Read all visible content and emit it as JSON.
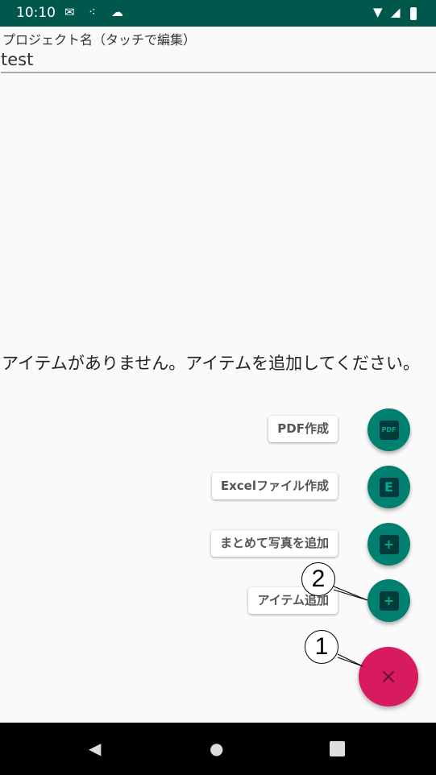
{
  "status_bar": {
    "time": "10:10",
    "icons": [
      "gmail-icon",
      "dots-icon",
      "cloud-icon",
      "wifi-icon",
      "signal-icon",
      "battery-icon"
    ]
  },
  "project": {
    "label": "プロジェクト名（タッチで編集）",
    "value": "test"
  },
  "empty_message": "アイテムがありません。アイテムを追加してください。",
  "fab_menu": [
    {
      "label": "PDF作成",
      "icon": "pdf-icon",
      "glyph": "PDF"
    },
    {
      "label": "Excelファイル作成",
      "icon": "excel-icon",
      "glyph": "E"
    },
    {
      "label": "まとめて写真を追加",
      "icon": "add-photos-icon",
      "glyph": "+"
    },
    {
      "label": "アイテム追加",
      "icon": "add-item-icon",
      "glyph": "+"
    }
  ],
  "main_fab": {
    "icon": "close-icon",
    "glyph": "×",
    "color": "#d81b60"
  },
  "annotations": [
    "1",
    "2"
  ],
  "colors": {
    "status_bar": "#00574b",
    "fab": "#00806e",
    "accent": "#d81b60"
  }
}
